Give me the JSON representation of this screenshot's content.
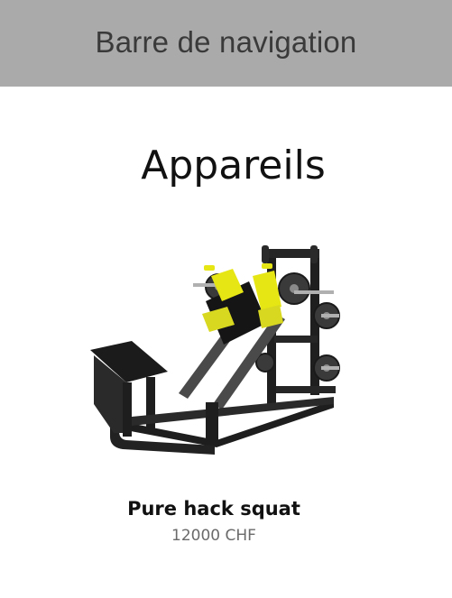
{
  "navbar": {
    "title": "Barre de navigation"
  },
  "page": {
    "heading": "Appareils"
  },
  "products": [
    {
      "name": "Pure hack squat",
      "price": "12000 CHF",
      "image_icon": "hack-squat-machine-image"
    }
  ],
  "colors": {
    "navbar_bg": "#aaaaaa",
    "navbar_text": "#3a3a3a",
    "accent_yellow": "#e6e614",
    "frame_dark": "#1e1e1e",
    "price_text": "#6a6a6a"
  }
}
